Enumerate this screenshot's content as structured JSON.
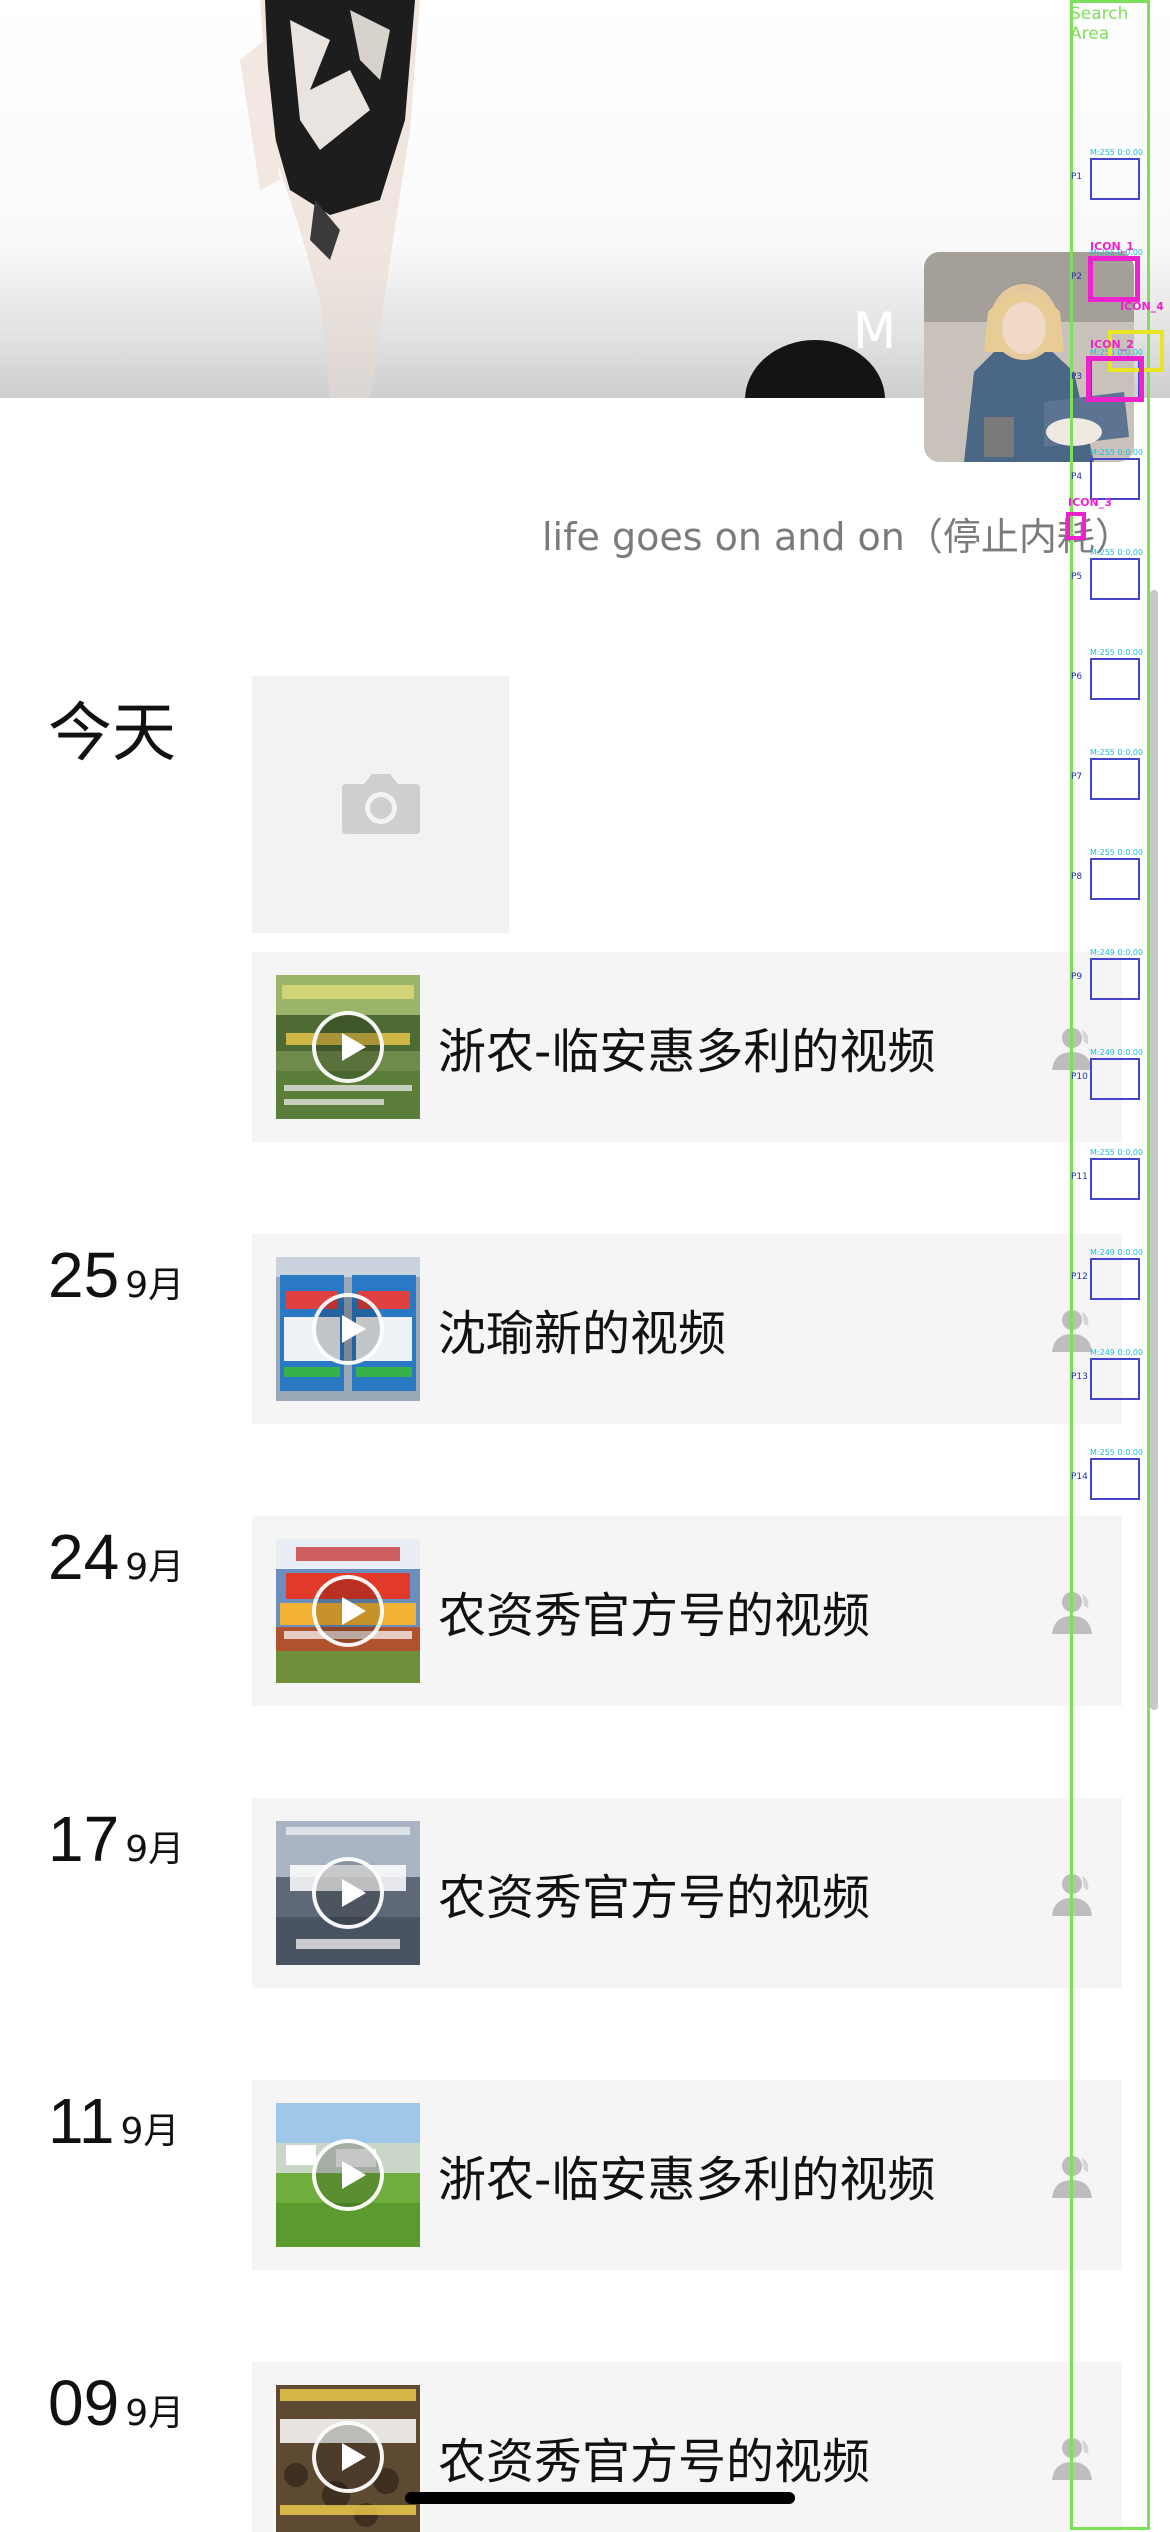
{
  "profile": {
    "name": "M",
    "signature": "life goes on and on（停止内耗）"
  },
  "feed": {
    "today_label": "今天",
    "entries": [
      {
        "day": "25",
        "month": "9月",
        "title": "沈瑜新的视频"
      },
      {
        "day": "24",
        "month": "9月",
        "title": "农资秀官方号的视频"
      },
      {
        "day": "17",
        "month": "9月",
        "title": "农资秀官方号的视频"
      },
      {
        "day": "11",
        "month": "9月",
        "title": "浙农-临安惠多利的视频"
      },
      {
        "day": "09",
        "month": "9月",
        "title": "农资秀官方号的视频"
      }
    ],
    "today_video_title": "浙农-临安惠多利的视频"
  },
  "overlay": {
    "search_area_label": "Search Area",
    "regions": [
      "P1",
      "P2",
      "P3",
      "P4",
      "P5",
      "P6",
      "P7",
      "P8",
      "P9",
      "P10",
      "P11",
      "P12",
      "P13",
      "P14"
    ],
    "metrics": [
      "M:255 0:0.00",
      "M:255 0:0.00",
      "M:255 0:0.00",
      "M:255 0:0.00",
      "M:255 0:0.00",
      "M:255 0:0.00",
      "M:255 0:0.00",
      "M:255 0:0.00",
      "M:249 0:0.00",
      "M:249 0:0.00",
      "M:255 0:0.00",
      "M:249 0:0.00",
      "M:249 0:0.00",
      "M:255 0:0.00"
    ],
    "icon_labels": [
      "ICON_1",
      "ICON_4",
      "ICON_2",
      "ICON_3"
    ]
  },
  "icons": {
    "camera": "camera-icon",
    "play": "play-icon",
    "person": "person-icon"
  },
  "colors": {
    "card_bg": "#f5f5f5",
    "signature_text": "#7b7b7b",
    "overlay_green": "#7de05a",
    "overlay_magenta": "#ee22cc"
  }
}
